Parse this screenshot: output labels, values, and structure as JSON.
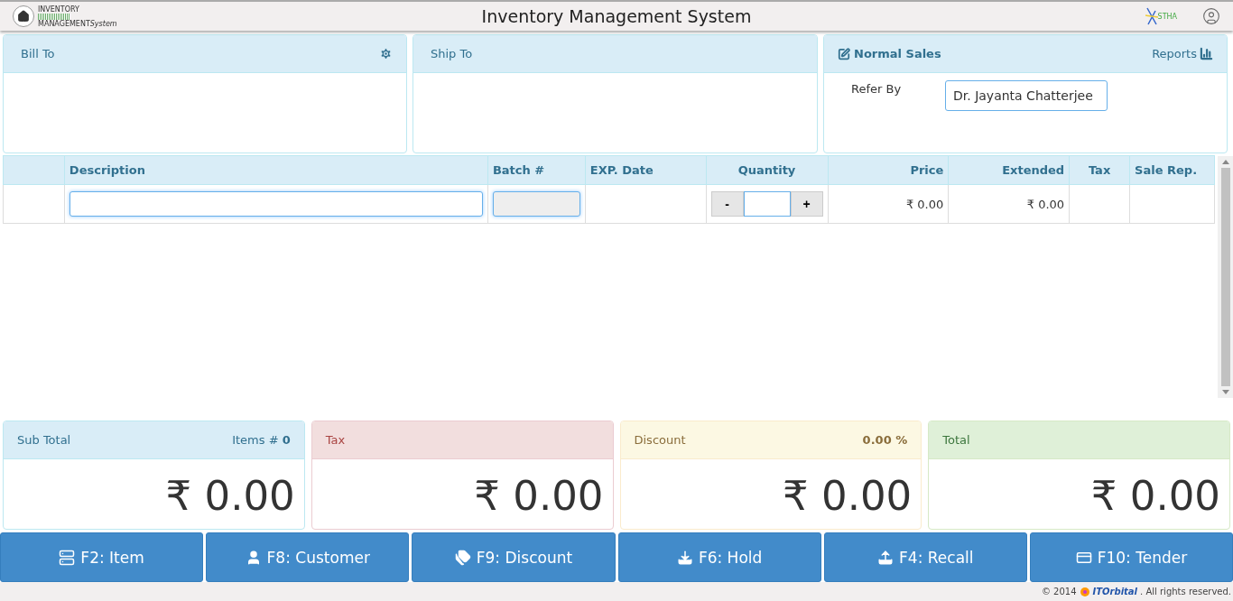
{
  "header": {
    "logo_top": "INVENTORY",
    "logo_bottom": "MANAGEMENT",
    "logo_suffix": "System",
    "title": "Inventory Management System",
    "brand": "STHA"
  },
  "bill_to": {
    "title": "Bill To"
  },
  "ship_to": {
    "title": "Ship To"
  },
  "sales": {
    "title": "Normal Sales",
    "reports": "Reports",
    "refer_label": "Refer By",
    "refer_value": "Dr. Jayanta Chatterjee"
  },
  "table": {
    "columns": [
      "",
      "Description",
      "Batch #",
      "EXP. Date",
      "Quantity",
      "Price",
      "Extended",
      "Tax",
      "Sale Rep."
    ],
    "rows": [
      {
        "description": "",
        "batch_disabled": true,
        "minus": "-",
        "plus": "+",
        "quantity": "",
        "price": "₹ 0.00",
        "extended": "₹ 0.00"
      }
    ]
  },
  "summary": [
    {
      "kind": "info",
      "title": "Sub Total",
      "extra": "Items # **0**",
      "amount": "₹ 0.00"
    },
    {
      "kind": "danger",
      "title": "Tax",
      "amount": "₹ 0.00"
    },
    {
      "kind": "warning",
      "title": "Discount",
      "extra": "**0.00 %**",
      "amount": "₹ 0.00"
    },
    {
      "kind": "success",
      "title": "Total",
      "amount": "₹ 0.00"
    }
  ],
  "actions": [
    {
      "kind": "item",
      "label": "F2: Item"
    },
    {
      "kind": "customer",
      "label": "F8: Customer"
    },
    {
      "kind": "discount",
      "label": "F9: Discount"
    },
    {
      "kind": "hold",
      "label": "F6: Hold"
    },
    {
      "kind": "recall",
      "label": "F4: Recall"
    },
    {
      "kind": "tender",
      "label": "F10: Tender"
    }
  ],
  "footer": {
    "copyright": "© 2014",
    "company": "ITOrbital",
    "rights": ". All rights reserved."
  }
}
